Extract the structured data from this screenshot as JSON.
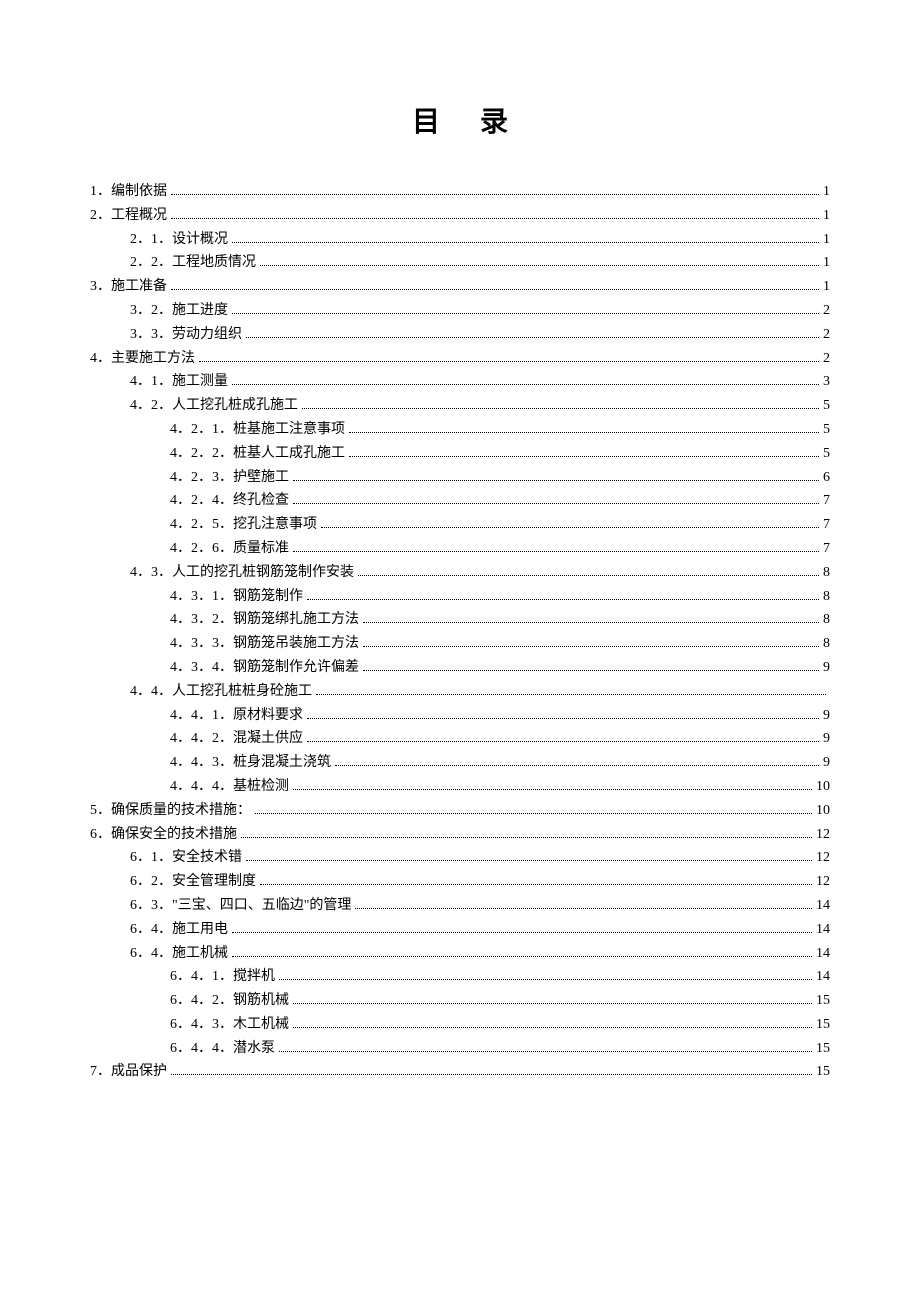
{
  "title": "目录",
  "entries": [
    {
      "level": 1,
      "label": "1．编制依据",
      "page": "1"
    },
    {
      "level": 1,
      "label": "2．工程概况",
      "page": "1"
    },
    {
      "level": 2,
      "label": "2．1．设计概况",
      "page": "1"
    },
    {
      "level": 2,
      "label": "2．2．工程地质情况",
      "page": "1"
    },
    {
      "level": 1,
      "label": "3．施工准备",
      "page": "1"
    },
    {
      "level": 2,
      "label": "3．2．施工进度",
      "page": "2"
    },
    {
      "level": 2,
      "label": "3．3．劳动力组织",
      "page": "2"
    },
    {
      "level": 1,
      "label": "4．主要施工方法",
      "page": "2"
    },
    {
      "level": 2,
      "label": "4．1．施工测量",
      "page": "3"
    },
    {
      "level": 2,
      "label": "4．2．人工挖孔桩成孔施工",
      "page": "5"
    },
    {
      "level": 3,
      "label": "4．2．1．桩基施工注意事项",
      "page": "5"
    },
    {
      "level": 3,
      "label": "4．2．2．桩基人工成孔施工",
      "page": "5"
    },
    {
      "level": 3,
      "label": "4．2．3．护壁施工",
      "page": "6"
    },
    {
      "level": 3,
      "label": "4．2．4．终孔检查",
      "page": "7"
    },
    {
      "level": 3,
      "label": "4．2．5．挖孔注意事项",
      "page": "7"
    },
    {
      "level": 3,
      "label": "4．2．6．质量标准",
      "page": "7"
    },
    {
      "level": 2,
      "label": "4．3．人工的挖孔桩钢筋笼制作安装",
      "page": "8"
    },
    {
      "level": 3,
      "label": "4．3．1．钢筋笼制作",
      "page": "8"
    },
    {
      "level": 3,
      "label": "4．3．2．钢筋笼绑扎施工方法",
      "page": "8"
    },
    {
      "level": 3,
      "label": "4．3．3．钢筋笼吊装施工方法",
      "page": "8"
    },
    {
      "level": 3,
      "label": "4．3．4．钢筋笼制作允许偏差",
      "page": "9"
    },
    {
      "level": 2,
      "label": "4．4．人工挖孔桩桩身砼施工",
      "page": ""
    },
    {
      "level": 3,
      "label": "4．4．1．原材料要求",
      "page": "9"
    },
    {
      "level": 3,
      "label": "4．4．2．混凝土供应",
      "page": "9"
    },
    {
      "level": 3,
      "label": "4．4．3．桩身混凝土浇筑",
      "page": "9"
    },
    {
      "level": 3,
      "label": "4．4．4．基桩检测",
      "page": "10"
    },
    {
      "level": 1,
      "label": "5．确保质量的技术措施：",
      "page": "10"
    },
    {
      "level": 1,
      "label": "6．确保安全的技术措施",
      "page": "12"
    },
    {
      "level": 2,
      "label": "6．1．安全技术错",
      "page": "12"
    },
    {
      "level": 2,
      "label": "6．2．安全管理制度",
      "page": "12"
    },
    {
      "level": 2,
      "label": "6．3．\"三宝、四口、五临边\"的管理",
      "page": "14"
    },
    {
      "level": 2,
      "label": "6．4．施工用电",
      "page": "14"
    },
    {
      "level": 2,
      "label": "6．4．施工机械",
      "page": "14"
    },
    {
      "level": 3,
      "label": "6．4．1．搅拌机",
      "page": "14"
    },
    {
      "level": 3,
      "label": "6．4．2．钢筋机械",
      "page": "15"
    },
    {
      "level": 3,
      "label": "6．4．3．木工机械",
      "page": "15"
    },
    {
      "level": 3,
      "label": "6．4．4．潜水泵",
      "page": "15"
    },
    {
      "level": 1,
      "label": "7．成品保护",
      "page": "15"
    }
  ]
}
